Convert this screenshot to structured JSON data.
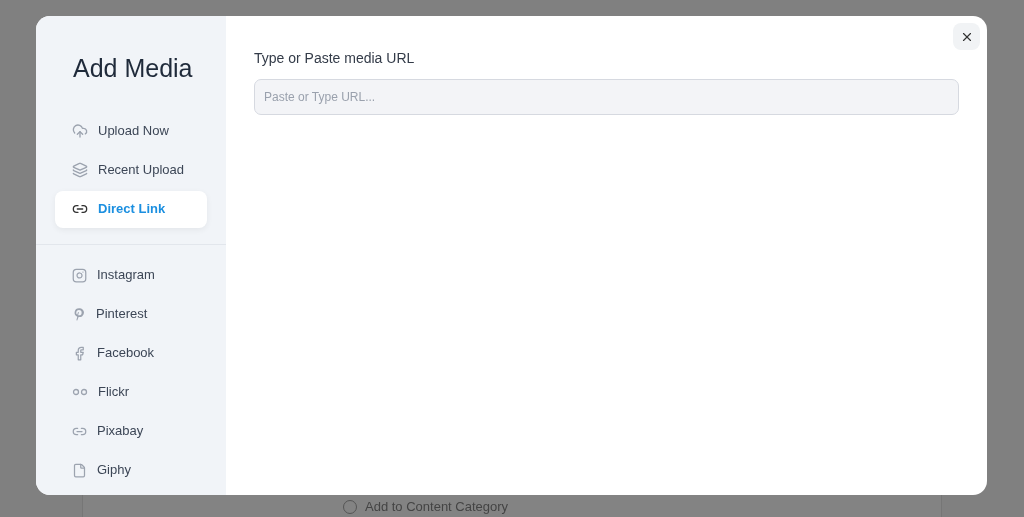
{
  "background": {
    "radio": {
      "label": "Add to Content Category",
      "checked": false
    }
  },
  "modal": {
    "title": "Add Media",
    "nav_groups": [
      {
        "items": [
          {
            "label": "Upload Now",
            "selected": false
          },
          {
            "label": "Recent Upload",
            "selected": false
          },
          {
            "label": "Direct Link",
            "selected": true
          }
        ]
      },
      {
        "items": [
          {
            "label": "Instagram",
            "selected": false
          },
          {
            "label": "Pinterest",
            "selected": false
          },
          {
            "label": "Facebook",
            "selected": false
          },
          {
            "label": "Flickr",
            "selected": false
          },
          {
            "label": "Pixabay",
            "selected": false
          },
          {
            "label": "Giphy",
            "selected": false
          }
        ]
      }
    ],
    "url_field": {
      "label": "Type or Paste media URL",
      "placeholder": "Paste or Type URL..."
    }
  }
}
